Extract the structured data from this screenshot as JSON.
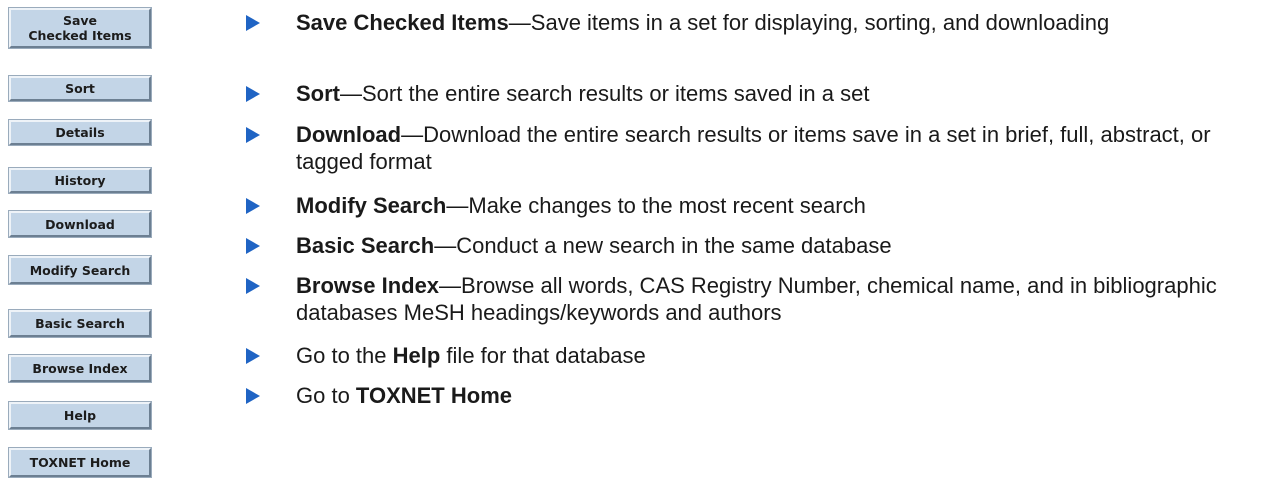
{
  "buttons": {
    "save_checked_items": {
      "line1": "Save",
      "line2": "Checked Items"
    },
    "sort": "Sort",
    "details": "Details",
    "history": "History",
    "download": "Download",
    "modify_search": "Modify Search",
    "basic_search": "Basic Search",
    "browse_index": "Browse Index",
    "help": "Help",
    "toxnet_home": "TOXNET Home"
  },
  "descriptions": [
    {
      "term": "Save Checked Items",
      "text": "—Save items in a set for displaying, sorting, and downloading"
    },
    {
      "term": "Sort",
      "text": "—Sort the entire search results or items saved in a set"
    },
    {
      "term": "Download",
      "text": "—Download the entire search results or items save in a set in brief, full, abstract, or tagged format"
    },
    {
      "term": "Modify Search",
      "text": "—Make changes to the most recent search"
    },
    {
      "term": "Basic Search",
      "text": "—Conduct a new search in the same database"
    },
    {
      "term": "Browse Index",
      "text": "—Browse all words, CAS Registry Number, chemical name, and in bibliographic databases MeSH headings/keywords and authors"
    },
    {
      "prefix": "Go to the ",
      "term": "Help",
      "suffix": " file for that database"
    },
    {
      "prefix": "Go to ",
      "term": "TOXNET Home"
    }
  ],
  "colors": {
    "button_face": "#c3d5e7",
    "bullet_arrow": "#1f64c4"
  }
}
